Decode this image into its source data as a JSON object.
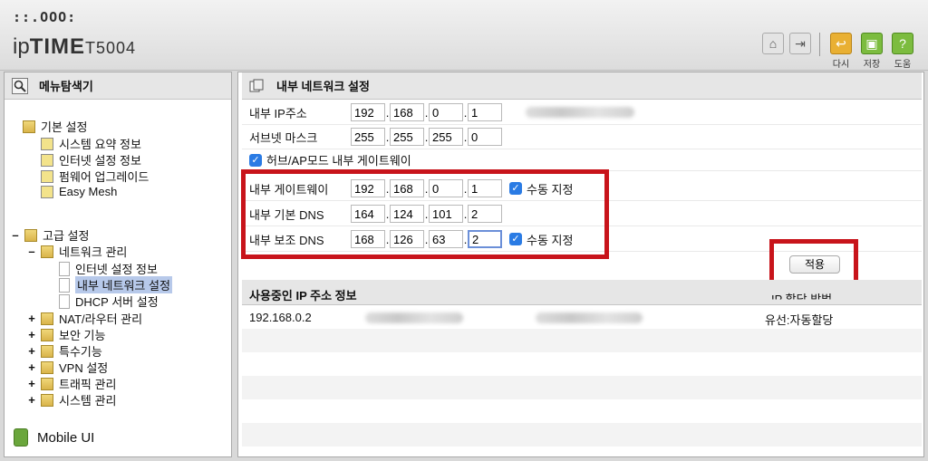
{
  "header": {
    "logo_dots": "::.OOO:",
    "logo_ip": "ip",
    "logo_time": "TIME",
    "logo_model": "T5004",
    "btn_labels": {
      "retry": "다시",
      "save": "저장",
      "help": "도움"
    }
  },
  "left": {
    "title": "메뉴탐색기",
    "basic": {
      "label": "기본 설정",
      "items": [
        "시스템 요약 정보",
        "인터넷 설정 정보",
        "펌웨어 업그레이드",
        "Easy Mesh"
      ]
    },
    "advanced": {
      "label": "고급 설정",
      "network": {
        "label": "네트워크 관리",
        "items": [
          "인터넷 설정 정보",
          "내부 네트워크 설정",
          "DHCP 서버 설정"
        ]
      },
      "others": [
        "NAT/라우터 관리",
        "보안 기능",
        "특수기능",
        "VPN 설정",
        "트래픽 관리",
        "시스템 관리"
      ],
      "expand_minus": "–",
      "expand_plus": "+"
    },
    "mobile": "Mobile UI"
  },
  "main": {
    "title": "내부 네트워크 설정",
    "rows": {
      "ip": {
        "label": "내부 IP주소",
        "octets": [
          "192",
          "168",
          "0",
          "1"
        ]
      },
      "subnet": {
        "label": "서브넷 마스크",
        "octets": [
          "255",
          "255",
          "255",
          "0"
        ]
      },
      "hub_ap": "허브/AP모드 내부 게이트웨이",
      "gateway": {
        "label": "내부 게이트웨이",
        "octets": [
          "192",
          "168",
          "0",
          "1"
        ],
        "manual": "수동 지정"
      },
      "dns1": {
        "label": "내부 기본 DNS",
        "octets": [
          "164",
          "124",
          "101",
          "2"
        ]
      },
      "dns2": {
        "label": "내부 보조 DNS",
        "octets": [
          "168",
          "126",
          "63",
          "2"
        ],
        "manual": "수동 지정"
      }
    },
    "apply": "적용",
    "info": {
      "title": "사용중인 IP 주소 정보",
      "col_right": "IP 할당 방법",
      "row_ip": "192.168.0.2",
      "row_type": "유선:자동할당"
    },
    "dot": "."
  },
  "colors": {
    "highlight": "#c8141b",
    "checkbox": "#2a7be4"
  }
}
